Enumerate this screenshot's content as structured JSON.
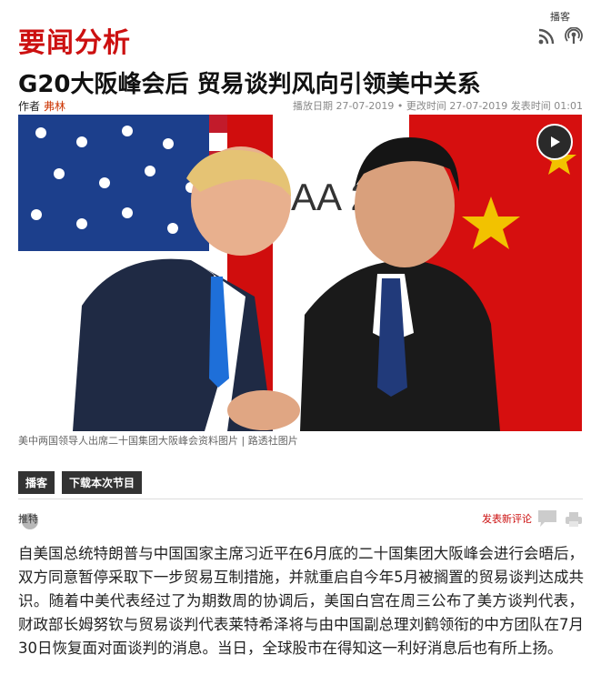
{
  "section": {
    "title": "要闻分析"
  },
  "podcast": {
    "label": "播客"
  },
  "icons": {
    "rss": "rss-icon",
    "podcast": "podcast-icon",
    "play": "play-icon",
    "share": "share-icon",
    "comment": "comment-icon",
    "print": "print-icon"
  },
  "article": {
    "headline": "G20大阪峰会后 贸易谈判风向引领美中关系",
    "author_label": "作者",
    "author_name": "弗林",
    "dates": "播放日期 27-07-2019 • 更改时间 27-07-2019 发表时间 01:01",
    "image_caption": "美中两国领导人出席二十国集团大阪峰会资料图片 | 路透社图片",
    "image_text": "AA 2019",
    "body": "自美国总统特朗普与中国国家主席习近平在6月底的二十国集团大阪峰会进行会晤后，双方同意暂停采取下一步贸易互制措施，并就重启自今年5月被搁置的贸易谈判达成共识。随着中美代表经过了为期数周的协调后，美国白宫在周三公布了美方谈判代表，财政部长姆努钦与贸易谈判代表莱特希泽将与由中国副总理刘鹤领衔的中方团队在7月30日恢复面对面谈判的消息。当日，全球股市在得知这一利好消息后也有所上扬。"
  },
  "buttons": {
    "podcast": "播客",
    "download": "下载本次节目"
  },
  "actions": {
    "share": "推特",
    "new_comment": "发表新评论"
  },
  "colors": {
    "accent": "#cc1010",
    "author": "#cc3300",
    "button_bg": "#333333"
  }
}
